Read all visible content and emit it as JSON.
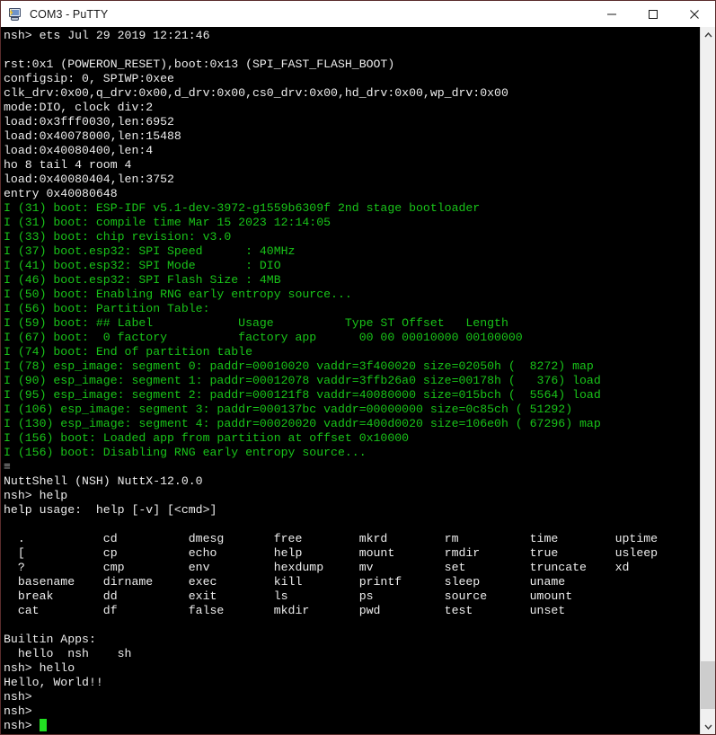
{
  "window": {
    "title": "COM3 - PuTTY",
    "icon": "putty-terminal-icon",
    "minimize_label": "—",
    "maximize_label": "□",
    "close_label": "✕"
  },
  "colors": {
    "background": "#000000",
    "white_text": "#ededed",
    "green_text": "#19c419",
    "cursor": "#22e022",
    "border": "#5a2c2c",
    "titlebar": "#ffffff",
    "scrollbar_track": "#f0f0f0",
    "scrollbar_thumb": "#cdcdcd"
  },
  "scrollbar": {
    "up_arrow": "scroll-up-arrow",
    "down_arrow": "scroll-down-arrow",
    "thumb_top_pct": 91.5,
    "thumb_height_pct": 7.0
  },
  "terminal": {
    "lines": [
      {
        "color": "white",
        "text": "nsh> ets Jul 29 2019 12:21:46"
      },
      {
        "color": "white",
        "text": ""
      },
      {
        "color": "white",
        "text": "rst:0x1 (POWERON_RESET),boot:0x13 (SPI_FAST_FLASH_BOOT)"
      },
      {
        "color": "white",
        "text": "configsip: 0, SPIWP:0xee"
      },
      {
        "color": "white",
        "text": "clk_drv:0x00,q_drv:0x00,d_drv:0x00,cs0_drv:0x00,hd_drv:0x00,wp_drv:0x00"
      },
      {
        "color": "white",
        "text": "mode:DIO, clock div:2"
      },
      {
        "color": "white",
        "text": "load:0x3fff0030,len:6952"
      },
      {
        "color": "white",
        "text": "load:0x40078000,len:15488"
      },
      {
        "color": "white",
        "text": "load:0x40080400,len:4"
      },
      {
        "color": "white",
        "text": "ho 8 tail 4 room 4"
      },
      {
        "color": "white",
        "text": "load:0x40080404,len:3752"
      },
      {
        "color": "white",
        "text": "entry 0x40080648"
      },
      {
        "color": "green",
        "text": "I (31) boot: ESP-IDF v5.1-dev-3972-g1559b6309f 2nd stage bootloader"
      },
      {
        "color": "green",
        "text": "I (31) boot: compile time Mar 15 2023 12:14:05"
      },
      {
        "color": "green",
        "text": "I (33) boot: chip revision: v3.0"
      },
      {
        "color": "green",
        "text": "I (37) boot.esp32: SPI Speed      : 40MHz"
      },
      {
        "color": "green",
        "text": "I (41) boot.esp32: SPI Mode       : DIO"
      },
      {
        "color": "green",
        "text": "I (46) boot.esp32: SPI Flash Size : 4MB"
      },
      {
        "color": "green",
        "text": "I (50) boot: Enabling RNG early entropy source..."
      },
      {
        "color": "green",
        "text": "I (56) boot: Partition Table:"
      },
      {
        "color": "green",
        "text": "I (59) boot: ## Label            Usage          Type ST Offset   Length"
      },
      {
        "color": "green",
        "text": "I (67) boot:  0 factory          factory app      00 00 00010000 00100000"
      },
      {
        "color": "green",
        "text": "I (74) boot: End of partition table"
      },
      {
        "color": "green",
        "text": "I (78) esp_image: segment 0: paddr=00010020 vaddr=3f400020 size=02050h (  8272) map"
      },
      {
        "color": "green",
        "text": "I (90) esp_image: segment 1: paddr=00012078 vaddr=3ffb26a0 size=00178h (   376) load"
      },
      {
        "color": "green",
        "text": "I (95) esp_image: segment 2: paddr=000121f8 vaddr=40080000 size=015bch (  5564) load"
      },
      {
        "color": "green",
        "text": "I (106) esp_image: segment 3: paddr=000137bc vaddr=00000000 size=0c85ch ( 51292)"
      },
      {
        "color": "green",
        "text": "I (130) esp_image: segment 4: paddr=00020020 vaddr=400d0020 size=106e0h ( 67296) map"
      },
      {
        "color": "green",
        "text": "I (156) boot: Loaded app from partition at offset 0x10000"
      },
      {
        "color": "green",
        "text": "I (156) boot: Disabling RNG early entropy source..."
      },
      {
        "color": "gray",
        "text": "≡"
      },
      {
        "color": "white",
        "text": "NuttShell (NSH) NuttX-12.0.0"
      },
      {
        "color": "white",
        "text": "nsh> help"
      },
      {
        "color": "white",
        "text": "help usage:  help [-v] [<cmd>]"
      },
      {
        "color": "white",
        "text": ""
      },
      {
        "color": "white",
        "text": "  .           cd          dmesg       free        mkrd        rm          time        uptime"
      },
      {
        "color": "white",
        "text": "  [           cp          echo        help        mount       rmdir       true        usleep"
      },
      {
        "color": "white",
        "text": "  ?           cmp         env         hexdump     mv          set         truncate    xd"
      },
      {
        "color": "white",
        "text": "  basename    dirname     exec        kill        printf      sleep       uname"
      },
      {
        "color": "white",
        "text": "  break       dd          exit        ls          ps          source      umount"
      },
      {
        "color": "white",
        "text": "  cat         df          false       mkdir       pwd         test        unset"
      },
      {
        "color": "white",
        "text": ""
      },
      {
        "color": "white",
        "text": "Builtin Apps:"
      },
      {
        "color": "white",
        "text": "  hello  nsh    sh"
      },
      {
        "color": "white",
        "text": "nsh> hello"
      },
      {
        "color": "white",
        "text": "Hello, World!!"
      },
      {
        "color": "white",
        "text": "nsh>"
      },
      {
        "color": "white",
        "text": "nsh>"
      }
    ],
    "prompt_line": {
      "prompt": "nsh> ",
      "cursor": "block-cursor"
    }
  }
}
